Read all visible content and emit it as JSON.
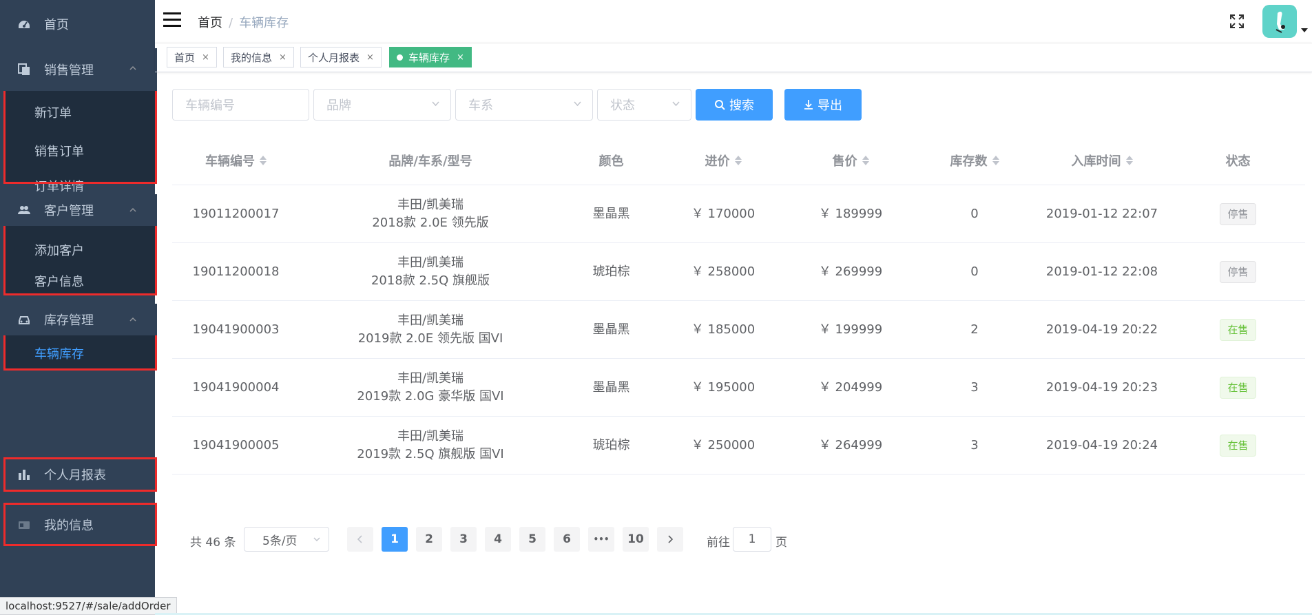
{
  "sidebar": {
    "home": "首页",
    "groups": [
      {
        "label": "销售管理",
        "icon": "documents-icon",
        "items": [
          "新订单",
          "销售订单",
          "订单详情"
        ]
      },
      {
        "label": "客户管理",
        "icon": "users-icon",
        "items": [
          "添加客户",
          "客户信息"
        ]
      },
      {
        "label": "库存管理",
        "icon": "car-icon",
        "items": [
          "车辆库存"
        ]
      }
    ],
    "report": "个人月报表",
    "myinfo": "我的信息"
  },
  "statusbar": "localhost:9527/#/sale/addOrder",
  "navbar": {
    "breadcrumb_home": "首页",
    "breadcrumb_current": "车辆库存"
  },
  "tags": [
    "首页",
    "我的信息",
    "个人月报表",
    "车辆库存"
  ],
  "filters": {
    "vehicle_no": "车辆编号",
    "brand": "品牌",
    "series": "车系",
    "status": "状态",
    "search": "搜索",
    "export": "导出"
  },
  "table": {
    "headers": [
      "车辆编号",
      "品牌/车系/型号",
      "颜色",
      "进价",
      "售价",
      "库存数",
      "入库时间",
      "状态"
    ],
    "rows": [
      {
        "no": "19011200017",
        "brand": "丰田/凯美瑞",
        "model": "2018款 2.0E 领先版",
        "color": "墨晶黑",
        "cost": "￥ 170000",
        "price": "￥ 189999",
        "stock": "0",
        "time": "2019-01-12 22:07",
        "status": "停售"
      },
      {
        "no": "19011200018",
        "brand": "丰田/凯美瑞",
        "model": "2018款 2.5Q 旗舰版",
        "color": "琥珀棕",
        "cost": "￥ 258000",
        "price": "￥ 269999",
        "stock": "0",
        "time": "2019-01-12 22:08",
        "status": "停售"
      },
      {
        "no": "19041900003",
        "brand": "丰田/凯美瑞",
        "model": "2019款 2.0E 领先版 国VI",
        "color": "墨晶黑",
        "cost": "￥ 185000",
        "price": "￥ 199999",
        "stock": "2",
        "time": "2019-04-19 20:22",
        "status": "在售"
      },
      {
        "no": "19041900004",
        "brand": "丰田/凯美瑞",
        "model": "2019款 2.0G 豪华版 国VI",
        "color": "墨晶黑",
        "cost": "￥ 195000",
        "price": "￥ 204999",
        "stock": "3",
        "time": "2019-04-19 20:23",
        "status": "在售"
      },
      {
        "no": "19041900005",
        "brand": "丰田/凯美瑞",
        "model": "2019款 2.5Q 旗舰版 国VI",
        "color": "琥珀棕",
        "cost": "￥ 250000",
        "price": "￥ 264999",
        "stock": "3",
        "time": "2019-04-19 20:24",
        "status": "在售"
      }
    ]
  },
  "pagination": {
    "total": "共 46 条",
    "page_size": "5条/页",
    "pages": [
      "1",
      "2",
      "3",
      "4",
      "5",
      "6",
      "•••",
      "10"
    ],
    "current": "1",
    "goto_label": "前往",
    "goto_value": "1",
    "goto_unit": "页"
  },
  "colors": {
    "sidebar_bg": "#304156",
    "submenu_bg": "#1f2d3d",
    "primary": "#409eff",
    "tag_active": "#42b983",
    "highlight_box": "#ee2b2b"
  }
}
